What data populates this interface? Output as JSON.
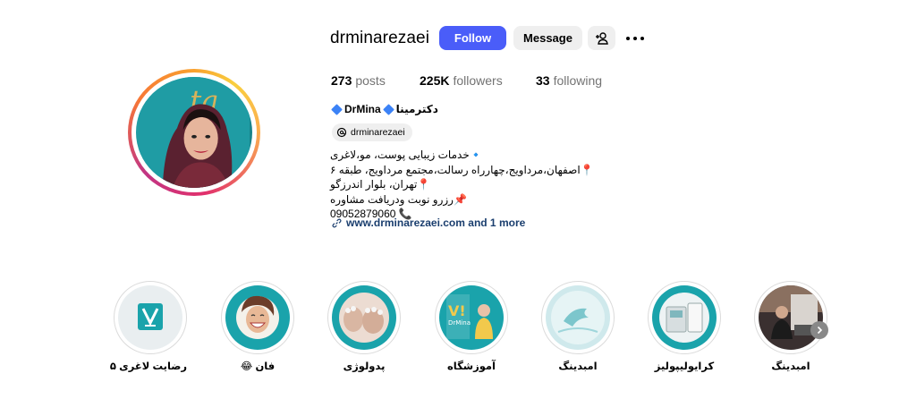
{
  "profile": {
    "username": "drminarezaei",
    "follow_label": "Follow",
    "message_label": "Message",
    "posts_count": "273",
    "posts_label": "posts",
    "followers_count": "225K",
    "followers_label": "followers",
    "following_count": "33",
    "following_label": "following",
    "display_name_en": "DrMina",
    "display_name_fa": "دکترمینا",
    "threads_handle": "drminarezaei",
    "bio_lines": [
      "🔹خدمات زیبایی پوست، مو،لاغری",
      "📍اصفهان،مرداویج،چهارراه رسالت،مجتمع مرداویج، طبقه ۶",
      "📍تهران، بلوار اندرزگو",
      "📌رزرو نوبت ودریافت مشاوره",
      "09052879060 📞"
    ],
    "link_text": "www.drminarezaei.com and 1 more"
  },
  "highlights": [
    {
      "label": "امبدینگ",
      "icon": "salon-photo"
    },
    {
      "label": "کرایولیپولیز",
      "icon": "device-photo"
    },
    {
      "label": "امبدینگ",
      "icon": "bird-graphic"
    },
    {
      "label": "آموزشگاه",
      "icon": "drmina-logo"
    },
    {
      "label": "پدولوژی",
      "icon": "feet-photo"
    },
    {
      "label": "فان 😂",
      "icon": "laughing-woman"
    },
    {
      "label": "رضایت لاغری ۵",
      "icon": "v-logo"
    }
  ],
  "colors": {
    "follow_button": "#4a5df9",
    "secondary_button": "#efefef",
    "verified_diamond": "#3b82f6",
    "link_text": "#1a3e6e",
    "teal_brand": "#1aa3ab"
  }
}
